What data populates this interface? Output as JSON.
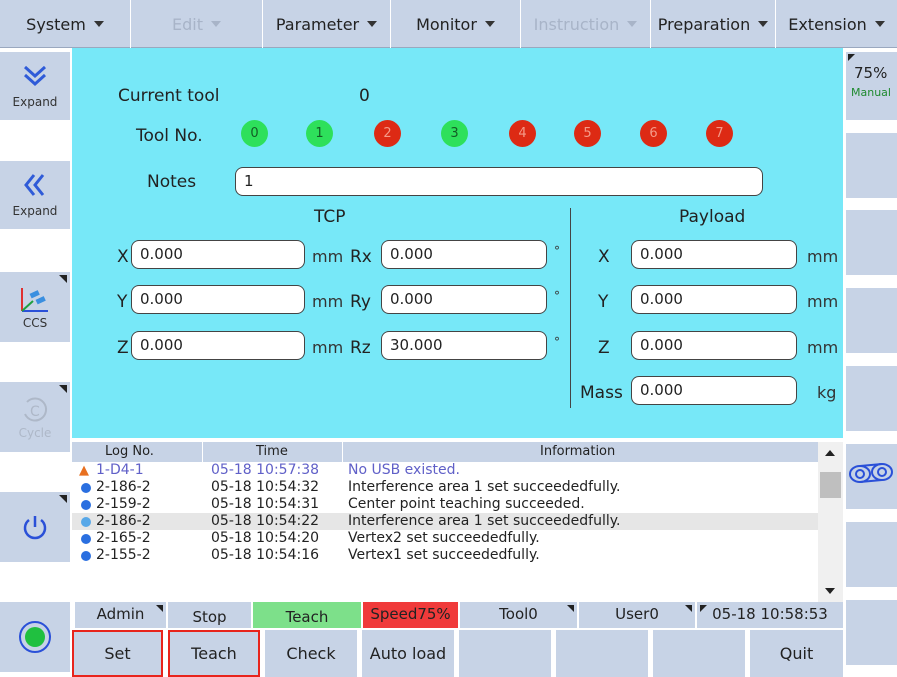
{
  "menu": [
    {
      "label": "System",
      "disabled": false
    },
    {
      "label": "Edit",
      "disabled": true
    },
    {
      "label": "Parameter",
      "disabled": false
    },
    {
      "label": "Monitor",
      "disabled": false
    },
    {
      "label": "Instruction",
      "disabled": true
    },
    {
      "label": "Preparation",
      "disabled": false
    },
    {
      "label": "Extension",
      "disabled": false
    }
  ],
  "left_sidebar": {
    "expand_down_label": "Expand",
    "expand_left_label": "Expand",
    "ccs_label": "CCS",
    "cycle_label": "Cycle",
    "power_icon": "power-icon",
    "record_icon": "record-icon"
  },
  "tool": {
    "current_tool_label": "Current tool",
    "current_tool_value": "0",
    "tool_no_label": "Tool No.",
    "tools": [
      {
        "n": "0",
        "status": "green"
      },
      {
        "n": "1",
        "status": "green"
      },
      {
        "n": "2",
        "status": "red"
      },
      {
        "n": "3",
        "status": "green"
      },
      {
        "n": "4",
        "status": "red"
      },
      {
        "n": "5",
        "status": "red"
      },
      {
        "n": "6",
        "status": "red"
      },
      {
        "n": "7",
        "status": "red"
      }
    ],
    "notes_label": "Notes",
    "notes_value": "1",
    "tcp_label": "TCP",
    "payload_label": "Payload",
    "tcp": {
      "x_label": "X",
      "x": "0.000",
      "y_label": "Y",
      "y": "0.000",
      "z_label": "Z",
      "z": "0.000",
      "rx_label": "Rx",
      "rx": "0.000",
      "ry_label": "Ry",
      "ry": "0.000",
      "rz_label": "Rz",
      "rz": "30.000",
      "mm_unit": "mm",
      "deg_unit": "°"
    },
    "payload": {
      "x_label": "X",
      "x": "0.000",
      "y_label": "Y",
      "y": "0.000",
      "z_label": "Z",
      "z": "0.000",
      "mass_label": "Mass",
      "mass": "0.000",
      "mm_unit": "mm",
      "kg_unit": "kg"
    }
  },
  "log": {
    "headers": {
      "no": "Log No.",
      "time": "Time",
      "info": "Information"
    },
    "rows": [
      {
        "no": "1-D4-1",
        "time": "05-18 10:57:38",
        "info": "No USB existed.",
        "level": "warning"
      },
      {
        "no": "2-186-2",
        "time": "05-18 10:54:32",
        "info": "Interference area 1 set succeededfully.",
        "level": "info"
      },
      {
        "no": "2-159-2",
        "time": "05-18 10:54:31",
        "info": "Center point teaching succeeded.",
        "level": "info"
      },
      {
        "no": "2-186-2",
        "time": "05-18 10:54:22",
        "info": "Interference area 1 set succeededfully.",
        "level": "info-selected"
      },
      {
        "no": "2-165-2",
        "time": "05-18 10:54:20",
        "info": "Vertex2 set succeededfully.",
        "level": "info"
      },
      {
        "no": "2-155-2",
        "time": "05-18 10:54:16",
        "info": "Vertex1 set succeededfully.",
        "level": "info"
      }
    ]
  },
  "status": {
    "user": "Admin",
    "run_state": "Stop",
    "mode": "Teach",
    "speed": "Speed75%",
    "tool": "Tool0",
    "user_frame": "User0",
    "datetime": "05-18 10:58:53"
  },
  "bottom_buttons": [
    "Set",
    "Teach",
    "Check",
    "Auto load",
    "",
    "",
    "",
    "Quit"
  ],
  "right_sidebar": {
    "speed_percent": "75%",
    "mode_label": "Manual"
  },
  "colors": {
    "panel_bg": "#77e8f8",
    "button_bg": "#c7d3e6",
    "tool_ok": "#2ee05b",
    "tool_err": "#dd2a14",
    "teach_bg": "#7de08a",
    "speed_bg": "#f03a3a",
    "highlight_border": "#e8241c"
  }
}
